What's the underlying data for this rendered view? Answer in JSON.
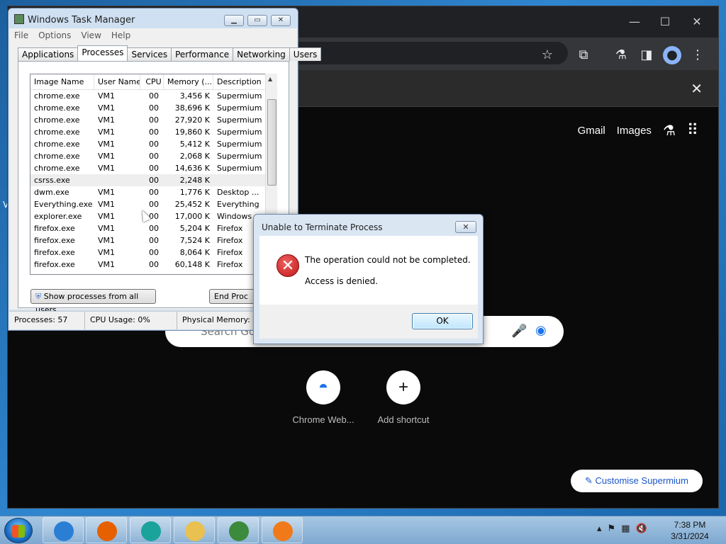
{
  "colors": {
    "chrome_bg": "#0a0a0a",
    "accent": "#1a56c8",
    "error": "#c01818"
  },
  "chrome": {
    "ntp_links": [
      "Gmail",
      "Images"
    ],
    "search_placeholder": "Search Go",
    "shortcuts": [
      {
        "label": "Chrome Web..."
      },
      {
        "label": "Add shortcut",
        "icon": "+"
      }
    ],
    "customise_label": "Customise Supermium"
  },
  "edge_text": "V",
  "task_manager": {
    "title": "Windows Task Manager",
    "menu": [
      "File",
      "Options",
      "View",
      "Help"
    ],
    "tabs": [
      "Applications",
      "Processes",
      "Services",
      "Performance",
      "Networking",
      "Users"
    ],
    "active_tab": "Processes",
    "columns": [
      "Image Name",
      "User Name",
      "CPU",
      "Memory (...",
      "Description"
    ],
    "rows": [
      {
        "name": "chrome.exe",
        "user": "VM1",
        "cpu": "00",
        "mem": "3,456 K",
        "desc": "Supermium"
      },
      {
        "name": "chrome.exe",
        "user": "VM1",
        "cpu": "00",
        "mem": "38,696 K",
        "desc": "Supermium"
      },
      {
        "name": "chrome.exe",
        "user": "VM1",
        "cpu": "00",
        "mem": "27,920 K",
        "desc": "Supermium"
      },
      {
        "name": "chrome.exe",
        "user": "VM1",
        "cpu": "00",
        "mem": "19,860 K",
        "desc": "Supermium"
      },
      {
        "name": "chrome.exe",
        "user": "VM1",
        "cpu": "00",
        "mem": "5,412 K",
        "desc": "Supermium"
      },
      {
        "name": "chrome.exe",
        "user": "VM1",
        "cpu": "00",
        "mem": "2,068 K",
        "desc": "Supermium"
      },
      {
        "name": "chrome.exe",
        "user": "VM1",
        "cpu": "00",
        "mem": "14,636 K",
        "desc": "Supermium"
      },
      {
        "name": "csrss.exe",
        "user": "",
        "cpu": "00",
        "mem": "2,248 K",
        "desc": ""
      },
      {
        "name": "dwm.exe",
        "user": "VM1",
        "cpu": "00",
        "mem": "1,776 K",
        "desc": "Desktop ..."
      },
      {
        "name": "Everything.exe",
        "user": "VM1",
        "cpu": "00",
        "mem": "25,452 K",
        "desc": "Everything"
      },
      {
        "name": "explorer.exe",
        "user": "VM1",
        "cpu": "00",
        "mem": "17,000 K",
        "desc": "Windows ..."
      },
      {
        "name": "firefox.exe",
        "user": "VM1",
        "cpu": "00",
        "mem": "5,204 K",
        "desc": "Firefox"
      },
      {
        "name": "firefox.exe",
        "user": "VM1",
        "cpu": "00",
        "mem": "7,524 K",
        "desc": "Firefox"
      },
      {
        "name": "firefox.exe",
        "user": "VM1",
        "cpu": "00",
        "mem": "8,064 K",
        "desc": "Firefox"
      },
      {
        "name": "firefox.exe",
        "user": "VM1",
        "cpu": "00",
        "mem": "60,148 K",
        "desc": "Firefox"
      }
    ],
    "selected_row": 7,
    "show_all_label": "Show processes from all users",
    "end_process_label": "End Proc",
    "status": {
      "processes": "Processes: 57",
      "cpu": "CPU Usage: 0%",
      "memory": "Physical Memory: 5"
    }
  },
  "dialog": {
    "title": "Unable to Terminate Process",
    "message": "The operation could not be completed.",
    "detail": "Access is denied.",
    "ok_label": "OK"
  },
  "taskbar": {
    "apps": [
      {
        "name": "internet-explorer-icon",
        "color": "#2a7fd4"
      },
      {
        "name": "firefox-icon",
        "color": "#e66000"
      },
      {
        "name": "supermium-icon",
        "color": "#1aa39a"
      },
      {
        "name": "file-explorer-icon",
        "color": "#e8c150"
      },
      {
        "name": "task-manager-icon",
        "color": "#3c8a3c"
      },
      {
        "name": "media-player-icon",
        "color": "#f07a1a"
      }
    ],
    "time": "7:38 PM",
    "date": "3/31/2024"
  }
}
